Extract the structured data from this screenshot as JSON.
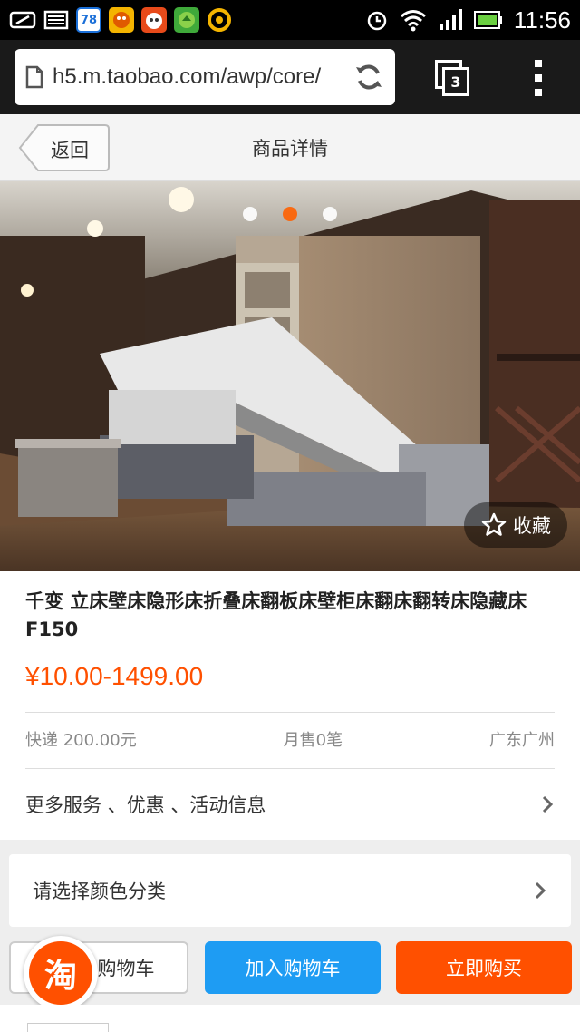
{
  "status_bar": {
    "time": "11:56",
    "badge_number": "78",
    "notifications": [
      "link-icon",
      "mail-icon",
      "badge-78",
      "game-icon-1",
      "game-icon-2",
      "game-icon-3",
      "qq-browser-icon"
    ],
    "system_icons": [
      "alarm-icon",
      "wifi-icon",
      "signal-icon",
      "battery-icon"
    ]
  },
  "browser": {
    "url": "h5.m.taobao.com/awp/core/…",
    "tab_count": "3"
  },
  "header": {
    "back_label": "返回",
    "title": "商品详情"
  },
  "gallery": {
    "slide_count": 3,
    "active_index": 1,
    "favorite_label": "收藏"
  },
  "product": {
    "title": "千变 立床壁床隐形床折叠床翻板床壁柜床翻床翻转床隐藏床 F150",
    "price": "¥10.00-1499.00",
    "shipping": "快递 200.00元",
    "monthly_sales": "月售0笔",
    "location": "广东广州",
    "more_services": "更多服务 、优惠 、活动信息"
  },
  "sku": {
    "select_label": "请选择颜色分类"
  },
  "actions": {
    "cart_label": "购物车",
    "add_to_cart_label": "加入购物车",
    "buy_now_label": "立即购买",
    "taobao_logo": "淘"
  },
  "colors": {
    "accent": "#ff5000",
    "blue": "#1e9cf3"
  }
}
